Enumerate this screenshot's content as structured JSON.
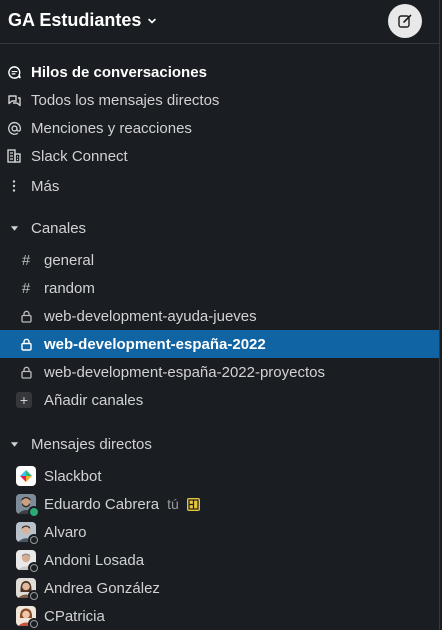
{
  "workspace": {
    "name": "GA Estudiantes"
  },
  "nav": [
    {
      "label": "Hilos de conversaciones",
      "bold": true
    },
    {
      "label": "Todos los mensajes directos"
    },
    {
      "label": "Menciones y reacciones"
    },
    {
      "label": "Slack Connect"
    },
    {
      "label": "Más"
    }
  ],
  "channels": {
    "title": "Canales",
    "items": [
      {
        "name": "general",
        "type": "public"
      },
      {
        "name": "random",
        "type": "public"
      },
      {
        "name": "web-development-ayuda-jueves",
        "type": "private"
      },
      {
        "name": "web-development-españa-2022",
        "type": "private",
        "selected": true
      },
      {
        "name": "web-development-españa-2022-proyectos",
        "type": "private"
      }
    ],
    "add_label": "Añadir canales"
  },
  "dms": {
    "title": "Mensajes directos",
    "items": [
      {
        "name": "Slackbot",
        "presence": "none"
      },
      {
        "name": "Eduardo Cabrera",
        "presence": "active",
        "you": "tú"
      },
      {
        "name": "Alvaro",
        "presence": "away"
      },
      {
        "name": "Andoni Losada",
        "presence": "away"
      },
      {
        "name": "Andrea González",
        "presence": "away"
      },
      {
        "name": "CPatricia",
        "presence": "away"
      }
    ]
  },
  "colors": {
    "background": "#1a1d21",
    "selected": "#1164a3",
    "active_presence": "#2bac76"
  }
}
